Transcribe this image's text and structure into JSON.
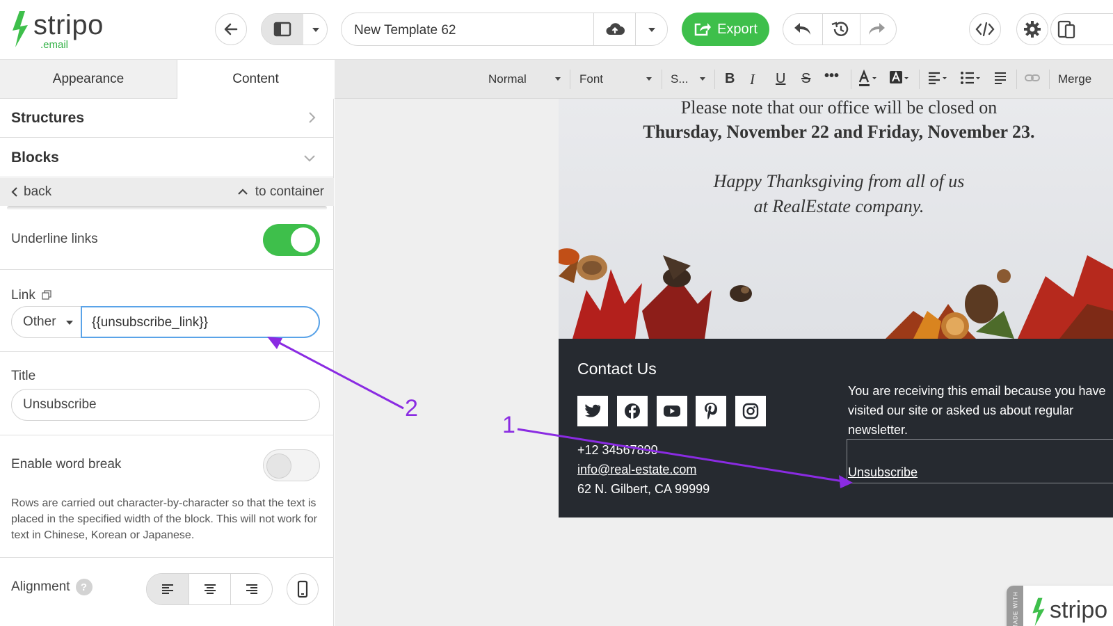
{
  "app": {
    "logo_word": "stripo",
    "logo_sub": ".email"
  },
  "toolbar": {
    "template_name": "New Template 62",
    "export_label": "Export"
  },
  "sidebar": {
    "tabs": [
      "Appearance",
      "Content"
    ],
    "active_tab": "Content",
    "sections": {
      "structures": "Structures",
      "blocks": "Blocks"
    },
    "back_label": "back",
    "to_container_label": "to container",
    "underline_links_label": "Underline links",
    "underline_links_on": true,
    "link_label": "Link",
    "link_type": "Other",
    "link_value": "{{unsubscribe_link}}",
    "title_label": "Title",
    "title_value": "Unsubscribe",
    "word_break_label": "Enable word break",
    "word_break_on": false,
    "word_break_help": "Rows are carried out character-by-character so that the text is placed in the specified width of the block. This will not work for text in Chinese, Korean or Japanese.",
    "alignment_label": "Alignment"
  },
  "format_bar": {
    "paragraph": "Normal",
    "font": "Font",
    "size": "S...",
    "merge": "Merge"
  },
  "email": {
    "line1": "Please note that our office will be closed on",
    "line2": "Thursday, November 22 and Friday, November 23.",
    "line3": "Happy Thanksgiving from all of us",
    "line4": "at RealEstate company.",
    "contact_heading": "Contact Us",
    "phone": "+12 34567890",
    "email_addr": "info@real-estate.com",
    "address": "62 N. Gilbert, CA 99999",
    "notice": "You are receiving this email because you have visited our site or asked us about regular newsletter.",
    "unsubscribe": "Unsubscribe",
    "badge_made_with": "MADE WITH",
    "badge_word": "stripo"
  },
  "annotations": {
    "marker_1": "1",
    "marker_2": "2",
    "color": "#8a2be2"
  },
  "colors": {
    "accent_green": "#3ebf4b",
    "focus_blue": "#5aa3e8",
    "footer_bg": "#262a30"
  }
}
